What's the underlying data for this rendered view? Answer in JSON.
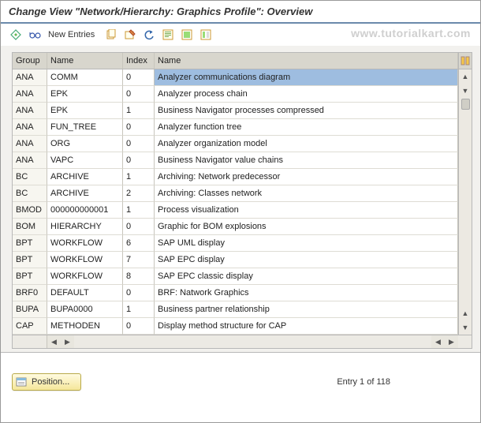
{
  "title": "Change View \"Network/Hierarchy: Graphics Profile\": Overview",
  "toolbar": {
    "new_entries": "New Entries"
  },
  "watermark": "www.tutorialkart.com",
  "columns": {
    "group": "Group",
    "name1": "Name",
    "index": "Index",
    "name2": "Name"
  },
  "rows": [
    {
      "group": "ANA",
      "name1": "COMM",
      "index": "0",
      "name2": "Analyzer communications diagram",
      "selected": true
    },
    {
      "group": "ANA",
      "name1": "EPK",
      "index": "0",
      "name2": "Analyzer process chain"
    },
    {
      "group": "ANA",
      "name1": "EPK",
      "index": "1",
      "name2": "Business Navigator processes compressed"
    },
    {
      "group": "ANA",
      "name1": "FUN_TREE",
      "index": "0",
      "name2": "Analyzer function tree"
    },
    {
      "group": "ANA",
      "name1": "ORG",
      "index": "0",
      "name2": "Analyzer organization model"
    },
    {
      "group": "ANA",
      "name1": "VAPC",
      "index": "0",
      "name2": "Business Navigator value chains"
    },
    {
      "group": "BC",
      "name1": "ARCHIVE",
      "index": "1",
      "name2": "Archiving: Network predecessor"
    },
    {
      "group": "BC",
      "name1": "ARCHIVE",
      "index": "2",
      "name2": "Archiving: Classes network"
    },
    {
      "group": "BMOD",
      "name1": "000000000001",
      "index": "1",
      "name2": "Process visualization"
    },
    {
      "group": "BOM",
      "name1": "HIERARCHY",
      "index": "0",
      "name2": "Graphic for BOM explosions"
    },
    {
      "group": "BPT",
      "name1": "WORKFLOW",
      "index": "6",
      "name2": "SAP UML display"
    },
    {
      "group": "BPT",
      "name1": "WORKFLOW",
      "index": "7",
      "name2": "SAP EPC display"
    },
    {
      "group": "BPT",
      "name1": "WORKFLOW",
      "index": "8",
      "name2": "SAP EPC classic display"
    },
    {
      "group": "BRF0",
      "name1": "DEFAULT",
      "index": "0",
      "name2": "BRF: Natwork Graphics"
    },
    {
      "group": "BUPA",
      "name1": "BUPA0000",
      "index": "1",
      "name2": "Business partner relationship"
    },
    {
      "group": "CAP",
      "name1": "METHODEN",
      "index": "0",
      "name2": "Display method structure for CAP"
    }
  ],
  "footer": {
    "position_label": "Position...",
    "entry_text": "Entry 1 of 118"
  }
}
